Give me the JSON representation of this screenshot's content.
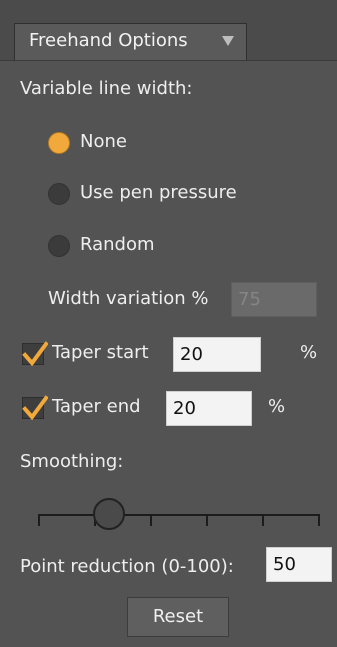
{
  "tab": {
    "title": "Freehand Options",
    "dropdown_icon": "chevron-down-icon"
  },
  "variable_line_width": {
    "label": "Variable line width:",
    "options": [
      {
        "label": "None",
        "selected": true
      },
      {
        "label": "Use pen pressure",
        "selected": false
      },
      {
        "label": "Random",
        "selected": false
      }
    ],
    "width_variation": {
      "label": "Width variation %",
      "value": "75",
      "disabled": true
    }
  },
  "taper_start": {
    "label": "Taper start",
    "checked": true,
    "value": "20",
    "unit": "%"
  },
  "taper_end": {
    "label": "Taper end",
    "checked": true,
    "value": "20",
    "unit": "%"
  },
  "smoothing": {
    "label": "Smoothing:",
    "level": 0.25,
    "ticks": 6
  },
  "point_reduction": {
    "label": "Point reduction (0-100):",
    "value": "50"
  },
  "reset_button": {
    "label": "Reset"
  },
  "colors": {
    "accent": "#f2a93b",
    "panel": "#535353",
    "input_bg": "#f3f3f3"
  }
}
